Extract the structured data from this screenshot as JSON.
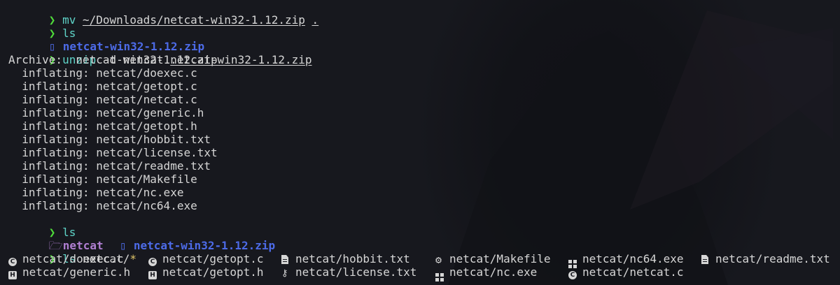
{
  "terminal": {
    "prompt_symbol": "❯",
    "lines": [
      {
        "cmd": "mv",
        "args": [
          "~/Downloads/netcat-win32-1.12.zip",
          "."
        ]
      },
      {
        "cmd": "ls"
      },
      {
        "ls_output": "netcat-win32-1.12.zip"
      },
      {
        "cmd": "unzip",
        "flag": "-d netcat",
        "arg": "netcat-win32-1.12.zip"
      }
    ],
    "archive_line": "Archive:  netcat-win32-1.12.zip",
    "inflating": [
      "  inflating: netcat/doexec.c",
      "  inflating: netcat/getopt.c",
      "  inflating: netcat/netcat.c",
      "  inflating: netcat/generic.h",
      "  inflating: netcat/getopt.h",
      "  inflating: netcat/hobbit.txt",
      "  inflating: netcat/license.txt",
      "  inflating: netcat/readme.txt",
      "  inflating: netcat/Makefile",
      "  inflating: netcat/nc.exe",
      "  inflating: netcat/nc64.exe"
    ],
    "ls2_cmd": "ls",
    "ls2_dir": "netcat",
    "ls2_zip": "netcat-win32-1.12.zip",
    "ls3_cmd": "ls",
    "ls3_arg": "netcat/",
    "ls3_glob": "*",
    "listing_row1": [
      {
        "icon": "c-icon",
        "name": "netcat/doexec.c"
      },
      {
        "icon": "c-icon",
        "name": "netcat/getopt.c"
      },
      {
        "icon": "text-file-icon",
        "name": "netcat/hobbit.txt"
      },
      {
        "icon": "gear-icon",
        "name": "netcat/Makefile"
      },
      {
        "icon": "windows-icon",
        "name": "netcat/nc64.exe"
      },
      {
        "icon": "text-file-icon",
        "name": "netcat/readme.txt"
      }
    ],
    "listing_row2": [
      {
        "icon": "h-icon",
        "name": "netcat/generic.h"
      },
      {
        "icon": "h-icon",
        "name": "netcat/getopt.h"
      },
      {
        "icon": "license-icon",
        "name": "netcat/license.txt"
      },
      {
        "icon": "windows-icon",
        "name": "netcat/nc.exe"
      },
      {
        "icon": "c-icon",
        "name": "netcat/netcat.c"
      }
    ]
  },
  "colors": {
    "background": "#17181e",
    "prompt": "#4fdc3a",
    "command": "#5fd4c8",
    "zip": "#4d6be8",
    "directory": "#b07fd2",
    "text": "#d6d6d6"
  }
}
